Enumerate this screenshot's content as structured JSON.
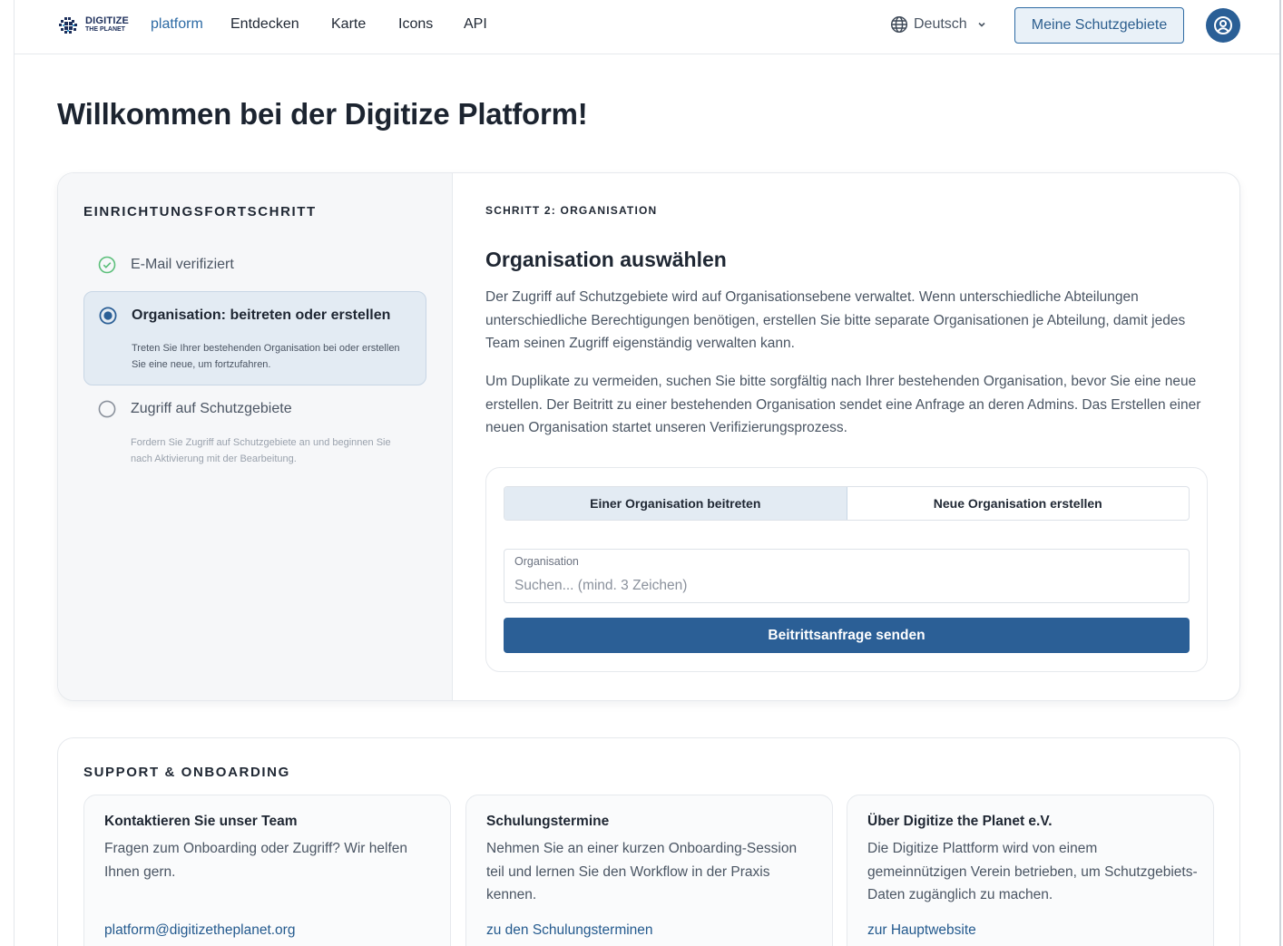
{
  "header": {
    "logo": {
      "line1": "DIGITIZE",
      "line2": "THE PLANET"
    },
    "brand_word": "platform",
    "nav": [
      "Entdecken",
      "Karte",
      "Icons",
      "API"
    ],
    "language": "Deutsch",
    "my_areas_button": "Meine Schutzgebiete"
  },
  "page_title": "Willkommen bei der Digitize Platform!",
  "progress": {
    "heading": "EINRICHTUNGSFORTSCHRITT",
    "steps": [
      {
        "title": "E-Mail verifiziert",
        "description": "",
        "state": "done"
      },
      {
        "title": "Organisation: beitreten oder erstellen",
        "description": "Treten Sie Ihrer bestehenden Organisation bei oder erstellen Sie eine neue, um fortzufahren.",
        "state": "current"
      },
      {
        "title": "Zugriff auf Schutzgebiete",
        "description": "Fordern Sie Zugriff auf Schutzgebiete an und beginnen Sie nach Aktivierung mit der Bearbeitung.",
        "state": "pending"
      }
    ]
  },
  "content": {
    "kicker": "SCHRITT 2: ORGANISATION",
    "title": "Organisation auswählen",
    "paragraph1": "Der Zugriff auf Schutzgebiete wird auf Organisationsebene verwaltet. Wenn unterschiedliche Abteilungen unterschiedliche Berechtigungen benötigen, erstellen Sie bitte separate Organisationen je Abteilung, damit jedes Team seinen Zugriff eigenständig verwalten kann.",
    "paragraph2": "Um Duplikate zu vermeiden, suchen Sie bitte sorgfältig nach Ihrer bestehenden Organisation, bevor Sie eine neue erstellen. Der Beitritt zu einer bestehenden Organisation sendet eine Anfrage an deren Admins. Das Erstellen einer neuen Organisation startet unseren Verifizierungsprozess.",
    "form": {
      "tabs": [
        "Einer Organisation beitreten",
        "Neue Organisation erstellen"
      ],
      "active_tab": 0,
      "field_label": "Organisation",
      "field_value": "",
      "field_placeholder": "Suchen... (mind. 3 Zeichen)",
      "submit": "Beitrittsanfrage senden"
    }
  },
  "support": {
    "heading": "SUPPORT & ONBOARDING",
    "cards": [
      {
        "title": "Kontaktieren Sie unser Team",
        "text": "Fragen zum Onboarding oder Zugriff? Wir helfen Ihnen gern.",
        "link": "platform@digitizetheplanet.org"
      },
      {
        "title": "Schulungstermine",
        "text": "Nehmen Sie an einer kurzen Onboarding-Session teil und lernen Sie den Workflow in der Praxis kennen.",
        "link": "zu den Schulungsterminen"
      },
      {
        "title": "Über Digitize the Planet e.V.",
        "text": "Die Digitize Plattform wird von einem gemeinnützigen Verein betrieben, um Schutzgebiets-Daten zugänglich zu machen.",
        "link": "zur Hauptwebsite"
      }
    ]
  },
  "colors": {
    "accent": "#2b5f96",
    "step_done": "#5bbf7a",
    "active_step_bg": "#e3ebf3"
  }
}
